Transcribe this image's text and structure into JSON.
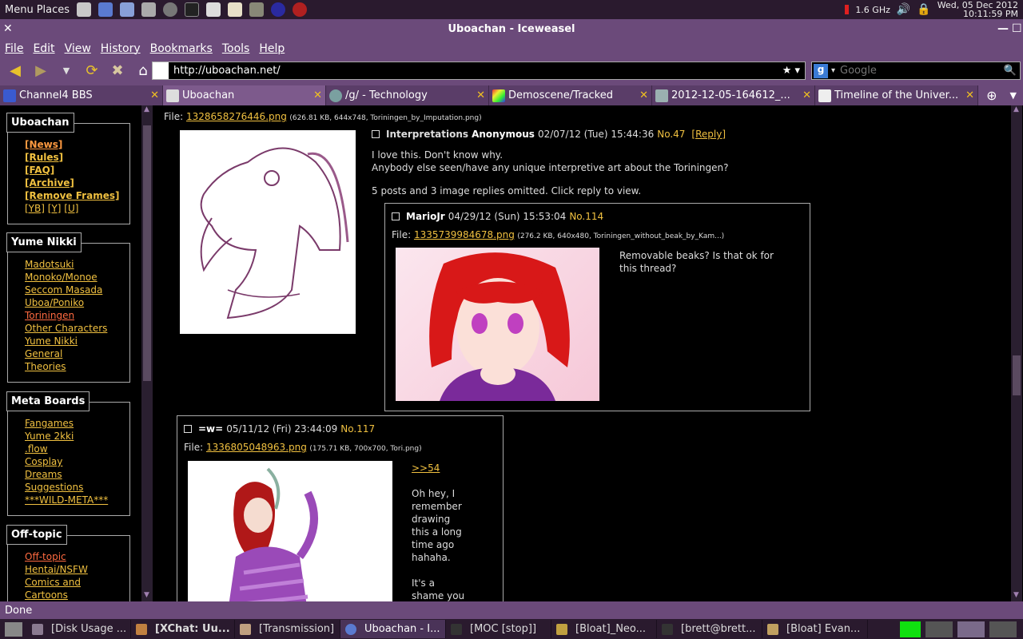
{
  "top_panel": {
    "menu_label": "Menu",
    "places_label": "Places",
    "cpu": "1.6 GHz",
    "date": "Wed, 05 Dec 2012",
    "time": "10:11:59 PM"
  },
  "window": {
    "title": "Uboachan - Iceweasel"
  },
  "menu": [
    "File",
    "Edit",
    "View",
    "History",
    "Bookmarks",
    "Tools",
    "Help"
  ],
  "nav": {
    "url": "http://uboachan.net/",
    "search_placeholder": "Google"
  },
  "tabs": [
    {
      "label": "Channel4 BBS"
    },
    {
      "label": "Uboachan"
    },
    {
      "label": "/g/ - Technology"
    },
    {
      "label": "Demoscene/Tracked"
    },
    {
      "label": "2012-12-05-164612_..."
    },
    {
      "label": "Timeline of the Univer..."
    }
  ],
  "sidebar": {
    "uboachan": {
      "title": "Uboachan",
      "items": [
        "[News]",
        "[Rules]",
        "[FAQ]",
        "[Archive]",
        "[Remove Frames]"
      ],
      "extra": [
        "[YB]",
        "[Y]",
        "[U]"
      ]
    },
    "yume_nikki": {
      "title": "Yume Nikki",
      "items": [
        "Madotsuki",
        "Monoko/Monoe",
        "Seccom Masada",
        "Uboa/Poniko",
        "Toriningen",
        "Other Characters",
        "Yume Nikki",
        "General",
        "Theories"
      ]
    },
    "meta": {
      "title": "Meta Boards",
      "items": [
        "Fangames",
        "Yume 2kki",
        ".flow",
        "Cosplay",
        "Dreams",
        "Suggestions",
        "***WILD-META***"
      ]
    },
    "offtopic": {
      "title": "Off-topic",
      "items": [
        "Off-topic",
        "Hentai/NSFW",
        "Comics and",
        "Cartoons"
      ]
    }
  },
  "thread": {
    "op_file_prefix": "File: ",
    "op_file": "1328658276446.png",
    "op_file_meta": "(626.81 KB, 644x748, Toriningen_by_Imputation.png)",
    "op_subject": "Interpretations",
    "op_name": "Anonymous",
    "op_date": "02/07/12 (Tue) 15:44:36",
    "op_no": "No.47",
    "op_reply": "[Reply]",
    "op_msg_1": "I love this. Don't know why.",
    "op_msg_2": "Anybody else seen/have any unique interpretive art about the Toriningen?",
    "omitted": "5 posts and 3 image replies omitted. Click reply to view."
  },
  "reply1": {
    "name": "MarioJr",
    "date": "04/29/12 (Sun) 15:53:04",
    "no": "No.114",
    "file_prefix": "File: ",
    "file": "1335739984678.png",
    "file_meta": "(276.2 KB, 640x480, Toriningen_without_beak_by_Kam...)",
    "msg_1": "Removable beaks? Is that ok for",
    "msg_2": "this thread?"
  },
  "reply2": {
    "name": "=w=",
    "date": "05/11/12 (Fri) 23:44:09",
    "no": "No.117",
    "file_prefix": "File: ",
    "file": "1336805048963.png",
    "file_meta": "(175.71 KB, 700x700, Tori.png)",
    "quote": ">>54",
    "msg": [
      "Oh hey, I",
      "remember",
      "drawing",
      "this a long",
      "time ago",
      "hahaha.",
      "",
      "It's a",
      "shame you"
    ]
  },
  "status": "Done",
  "taskbar": [
    "[Disk Usage ...",
    "[XChat: Uu...",
    "[Transmission]",
    "Uboachan - I...",
    "[MOC [stop]]",
    "[Bloat]_Neo...",
    "[brett@brett...",
    "[Bloat] Evan..."
  ]
}
